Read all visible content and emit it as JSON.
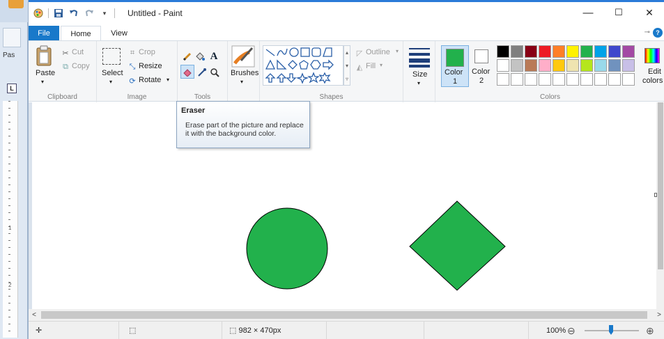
{
  "app": {
    "title": "Untitled - Paint"
  },
  "window_controls": {
    "minimize": "—",
    "maximize": "☐",
    "close": "✕"
  },
  "tabs": [
    {
      "label": "File",
      "active": false
    },
    {
      "label": "Home",
      "active": true
    },
    {
      "label": "View",
      "active": false
    }
  ],
  "ribbon": {
    "clipboard": {
      "paste": "Paste",
      "cut": "Cut",
      "copy": "Copy",
      "label": "Clipboard"
    },
    "image": {
      "select": "Select",
      "crop": "Crop",
      "resize": "Resize",
      "rotate": "Rotate",
      "label": "Image"
    },
    "tools": {
      "label": "Tools",
      "text_glyph": "A"
    },
    "brushes": {
      "label": "Brushes"
    },
    "shapes": {
      "outline": "Outline",
      "fill": "Fill",
      "label": "Shapes"
    },
    "size": {
      "label": "Size"
    },
    "colors": {
      "color1": "Color\n1",
      "color1_line1": "Color",
      "color1_line2": "1",
      "color2_line1": "Color",
      "color2_line2": "2",
      "edit": "Edit\ncolors",
      "edit_line1": "Edit",
      "edit_line2": "colors",
      "label": "Colors",
      "color1_value": "#22b14c",
      "color2_value": "#ffffff",
      "palette_row1": [
        "#000000",
        "#7f7f7f",
        "#880015",
        "#ed1c24",
        "#ff7f27",
        "#fff200",
        "#22b14c",
        "#00a2e8",
        "#3f48cc",
        "#a349a4"
      ],
      "palette_row2": [
        "#ffffff",
        "#c3c3c3",
        "#b97a57",
        "#ffaec9",
        "#ffc90e",
        "#efe4b0",
        "#b5e61d",
        "#99d9ea",
        "#7092be",
        "#c8bfe7"
      ],
      "palette_row3": [
        "#ffffff",
        "#ffffff",
        "#ffffff",
        "#ffffff",
        "#ffffff",
        "#ffffff",
        "#ffffff",
        "#ffffff",
        "#ffffff",
        "#ffffff"
      ]
    }
  },
  "tooltip": {
    "title": "Eraser",
    "description": "Erase part of the picture and replace it with the background color."
  },
  "canvas": {
    "shape_color": "#22b14c",
    "outline_color": "#000000"
  },
  "statusbar": {
    "dimensions": "982 × 470px",
    "zoom": "100%",
    "zoom_out": "⊖",
    "zoom_in": "⊕"
  },
  "ruler": {
    "labels": [
      "1",
      "2"
    ]
  }
}
